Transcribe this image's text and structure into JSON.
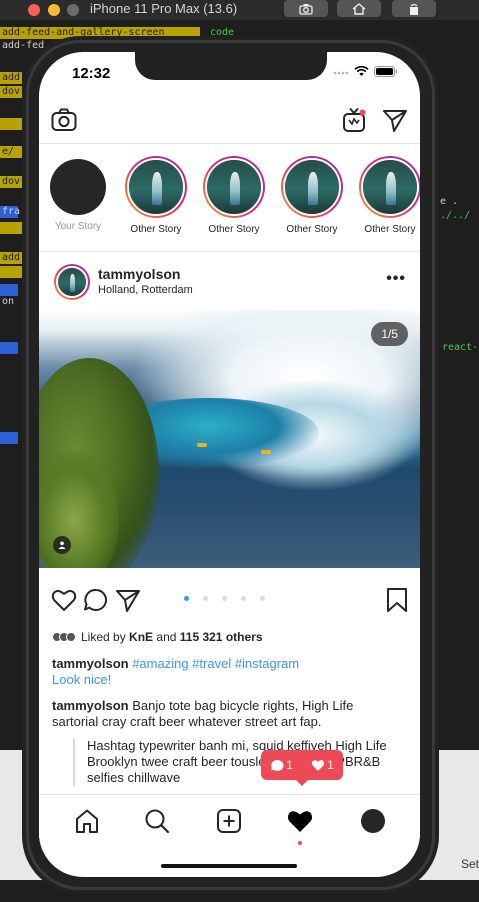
{
  "simulator": {
    "title": "iPhone 11 Pro Max (13.6)"
  },
  "editor_fragments": {
    "line1_branch": "add-feed-and-gallery-screen",
    "line1_folder": "code",
    "line2": "add-fed",
    "frag_add": "add",
    "frag_dov": "dov",
    "frag_slash": "e/",
    "frag_fra": "fra",
    "frag_on": "on",
    "frag_right1": "e .",
    "frag_right2": "./../",
    "frag_react": "react-",
    "setting_text": "Set"
  },
  "status_bar": {
    "time": "12:32"
  },
  "header": {
    "camera_icon": "camera-icon",
    "igtv_icon": "igtv-icon",
    "direct_icon": "paper-plane-icon"
  },
  "stories": [
    {
      "label": "Your Story",
      "is_own": true
    },
    {
      "label": "Other Story",
      "is_own": false
    },
    {
      "label": "Other Story",
      "is_own": false
    },
    {
      "label": "Other Story",
      "is_own": false
    },
    {
      "label": "Other Story",
      "is_own": false
    }
  ],
  "post": {
    "username": "tammyolson",
    "location": "Holland, Rotterdam",
    "more": "•••",
    "image_counter": "1/5",
    "carousel_total": 5,
    "carousel_active": 1,
    "likes_prefix": "Liked by",
    "likes_user": "KnE",
    "likes_and": "and",
    "likes_count": "115 321 others",
    "caption_user": "tammyolson",
    "caption_tags": "#amazing #travel #instagram",
    "caption_link": "Look nice!",
    "comment_user": "tammyolson",
    "comment_text": "Banjo tote bag bicycle rights, High Life sartorial cray craft beer whatever street art fap.",
    "quote_line1": "Hashtag typewriter banh mi, squid keffiyeh High Life",
    "quote_line2": "Brooklyn twee craft beer tousled chillwave. PBR&B",
    "quote_line3": "selfies chillwave"
  },
  "activity_popup": {
    "comments": "1",
    "likes": "1"
  },
  "tabbar": {
    "items": [
      "home-icon",
      "search-icon",
      "add-post-icon",
      "heart-icon",
      "profile-icon"
    ],
    "active": "heart-icon"
  },
  "colors": {
    "accent_blue": "#3897f0",
    "notification_red": "#ed4956"
  }
}
